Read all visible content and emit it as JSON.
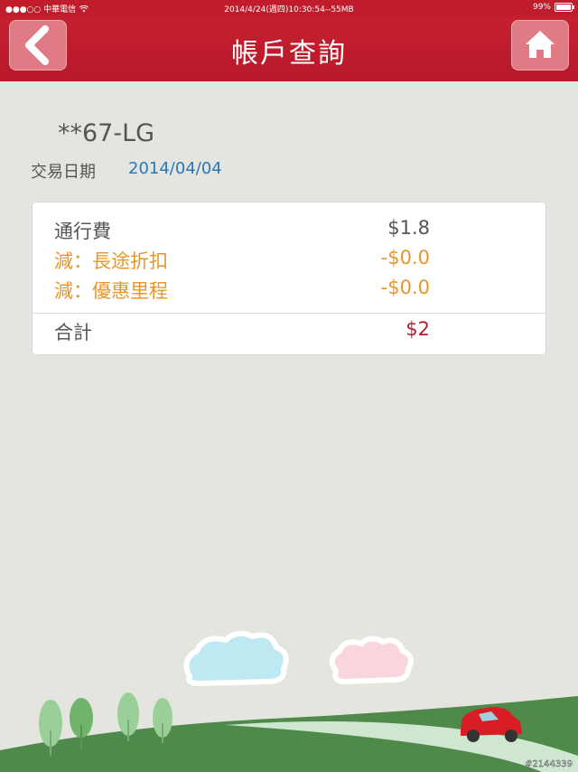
{
  "status_bar": {
    "carrier": "●●●○○ 中華電信",
    "datetime": "2014/4/24(週四)10:30:54--55MB",
    "battery": "99%"
  },
  "nav": {
    "title": "帳戶查詢",
    "back_icon": "chevron-left-icon",
    "home_icon": "home-icon"
  },
  "account": {
    "plate": "**67-LG",
    "date_label": "交易日期",
    "date_value": "2014/04/04"
  },
  "charges": {
    "fee_label": "通行費",
    "fee_value": "$1.8",
    "discount1_label": "減：長途折扣",
    "discount1_value": "-$0.0",
    "discount2_label": "減：優惠里程",
    "discount2_value": "-$0.0",
    "total_label": "合計",
    "total_value": "$2"
  },
  "colors": {
    "brand": "#c01c2b",
    "date": "#2a76b7",
    "discount": "#e8962b",
    "total": "#b21d30"
  },
  "watermark": "#2144339"
}
